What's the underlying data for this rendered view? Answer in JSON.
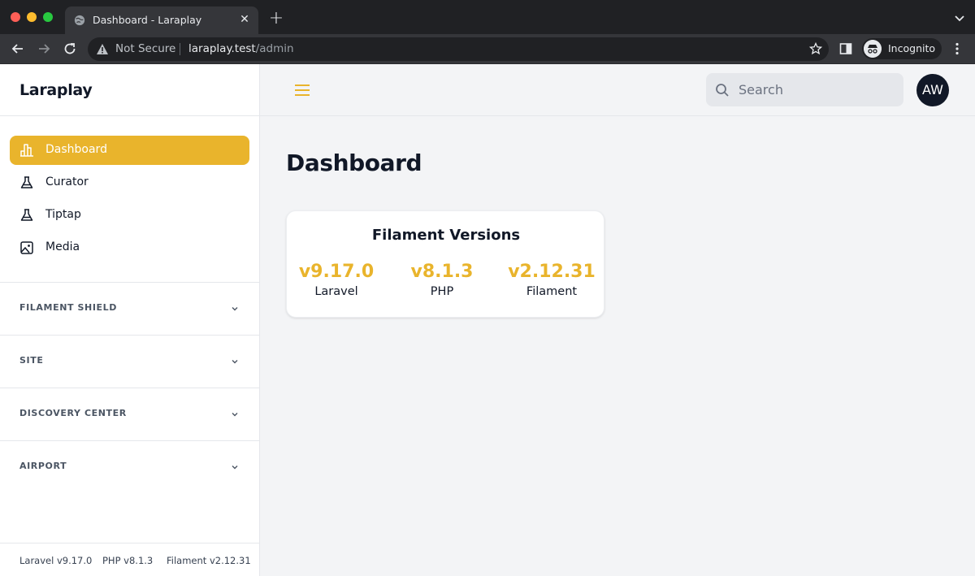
{
  "browser": {
    "tab_title": "Dashboard - Laraplay",
    "not_secure": "Not Secure",
    "url_host": "laraplay.test",
    "url_path": "/admin",
    "profile_label": "Incognito"
  },
  "sidebar": {
    "brand": "Laraplay",
    "items": [
      {
        "label": "Dashboard",
        "icon": "chart-bar-icon",
        "active": true
      },
      {
        "label": "Curator",
        "icon": "beaker-icon",
        "active": false
      },
      {
        "label": "Tiptap",
        "icon": "beaker-icon",
        "active": false
      },
      {
        "label": "Media",
        "icon": "photo-icon",
        "active": false
      }
    ],
    "groups": [
      {
        "label": "FILAMENT SHIELD"
      },
      {
        "label": "SITE"
      },
      {
        "label": "DISCOVERY CENTER"
      },
      {
        "label": "AIRPORT"
      }
    ],
    "footer": {
      "laravel": "Laravel v9.17.0",
      "php": "PHP v8.1.3",
      "filament": "Filament v2.12.31"
    }
  },
  "topbar": {
    "search_placeholder": "Search",
    "avatar_initials": "AW"
  },
  "main": {
    "title": "Dashboard",
    "card": {
      "title": "Filament Versions",
      "stats": [
        {
          "value": "v9.17.0",
          "label": "Laravel"
        },
        {
          "value": "v8.1.3",
          "label": "PHP"
        },
        {
          "value": "v2.12.31",
          "label": "Filament"
        }
      ]
    }
  },
  "colors": {
    "accent": "#e9b42c",
    "text": "#111827",
    "background": "#f3f4f6"
  }
}
